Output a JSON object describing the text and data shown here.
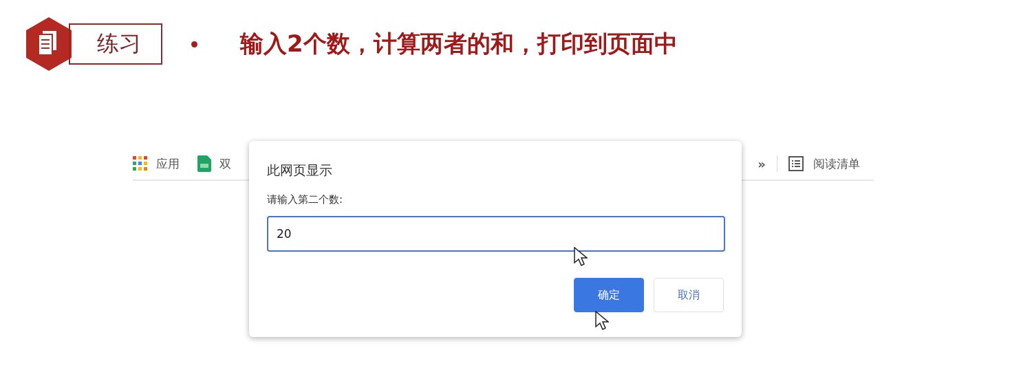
{
  "slide": {
    "tag": "练习",
    "title": "输入2个数，计算两者的和，打印到页面中"
  },
  "bookmarks_bar": {
    "items": [
      {
        "kind": "apps",
        "label": "应用"
      },
      {
        "kind": "sheet",
        "label": "双"
      }
    ],
    "overflow": "»",
    "reading_list": "阅读清单"
  },
  "dialog": {
    "title": "此网页显示",
    "message": "请输入第二个数:",
    "input": {
      "value": "20",
      "focused": true
    },
    "buttons": [
      {
        "label": "确定",
        "primary": true
      },
      {
        "label": "取消",
        "primary": false
      }
    ]
  }
}
